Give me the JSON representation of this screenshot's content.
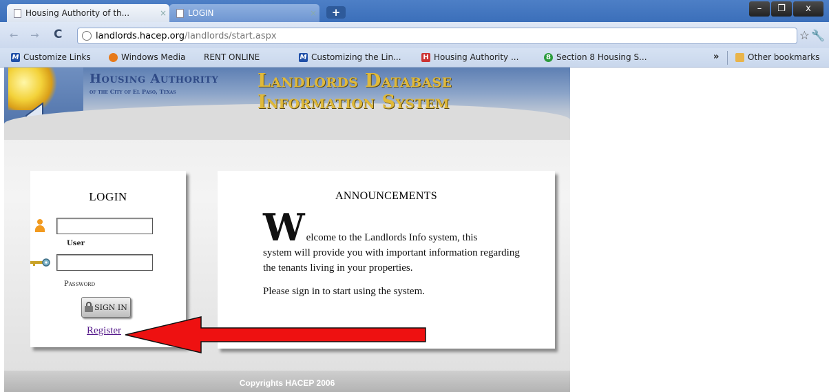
{
  "browser": {
    "tabs": [
      {
        "label": "Housing Authority of th...",
        "active": false
      },
      {
        "label": "LOGIN",
        "active": true
      }
    ],
    "url_host": "landlords.hacep.org",
    "url_path": "/landlords/start.aspx",
    "bookmarks": [
      {
        "label": "Customize Links",
        "icon": "m-icon"
      },
      {
        "label": "Windows Media",
        "icon": "windows-media-icon"
      },
      {
        "label": "RENT ONLINE",
        "icon": "page-icon"
      },
      {
        "label": "Customizing the Lin...",
        "icon": "m-icon"
      },
      {
        "label": "Housing Authority ...",
        "icon": "hat-icon"
      },
      {
        "label": "Section 8 Housing S...",
        "icon": "section8-icon"
      }
    ],
    "other_bookmarks": "Other bookmarks",
    "window_buttons": {
      "minimize": "–",
      "maximize": "❐",
      "close": "x"
    }
  },
  "header": {
    "org_name": "Housing Authority",
    "org_sub": "of the City of El Paso, Texas",
    "system_title": "Landlords Database Information System"
  },
  "login": {
    "title": "LOGIN",
    "user_label": "User",
    "password_label": "Password",
    "user_value": "",
    "password_value": "",
    "signin_label": "SIGN IN",
    "register_label": "Register"
  },
  "announcements": {
    "title": "ANNOUNCEMENTS",
    "dropcap": "W",
    "line1": "elcome to the Landlords Info system, this",
    "rest": "system will provide you with important information regarding the tenants living in your properties.",
    "p2": "Please sign in to start using the system."
  },
  "footer": {
    "copyright": "Copyrights HACEP 2006"
  },
  "colors": {
    "title_gold": "#e0b93a",
    "org_blue": "#2f4a86",
    "arrow_red": "#ee1111",
    "link_purple": "#551a8b"
  }
}
